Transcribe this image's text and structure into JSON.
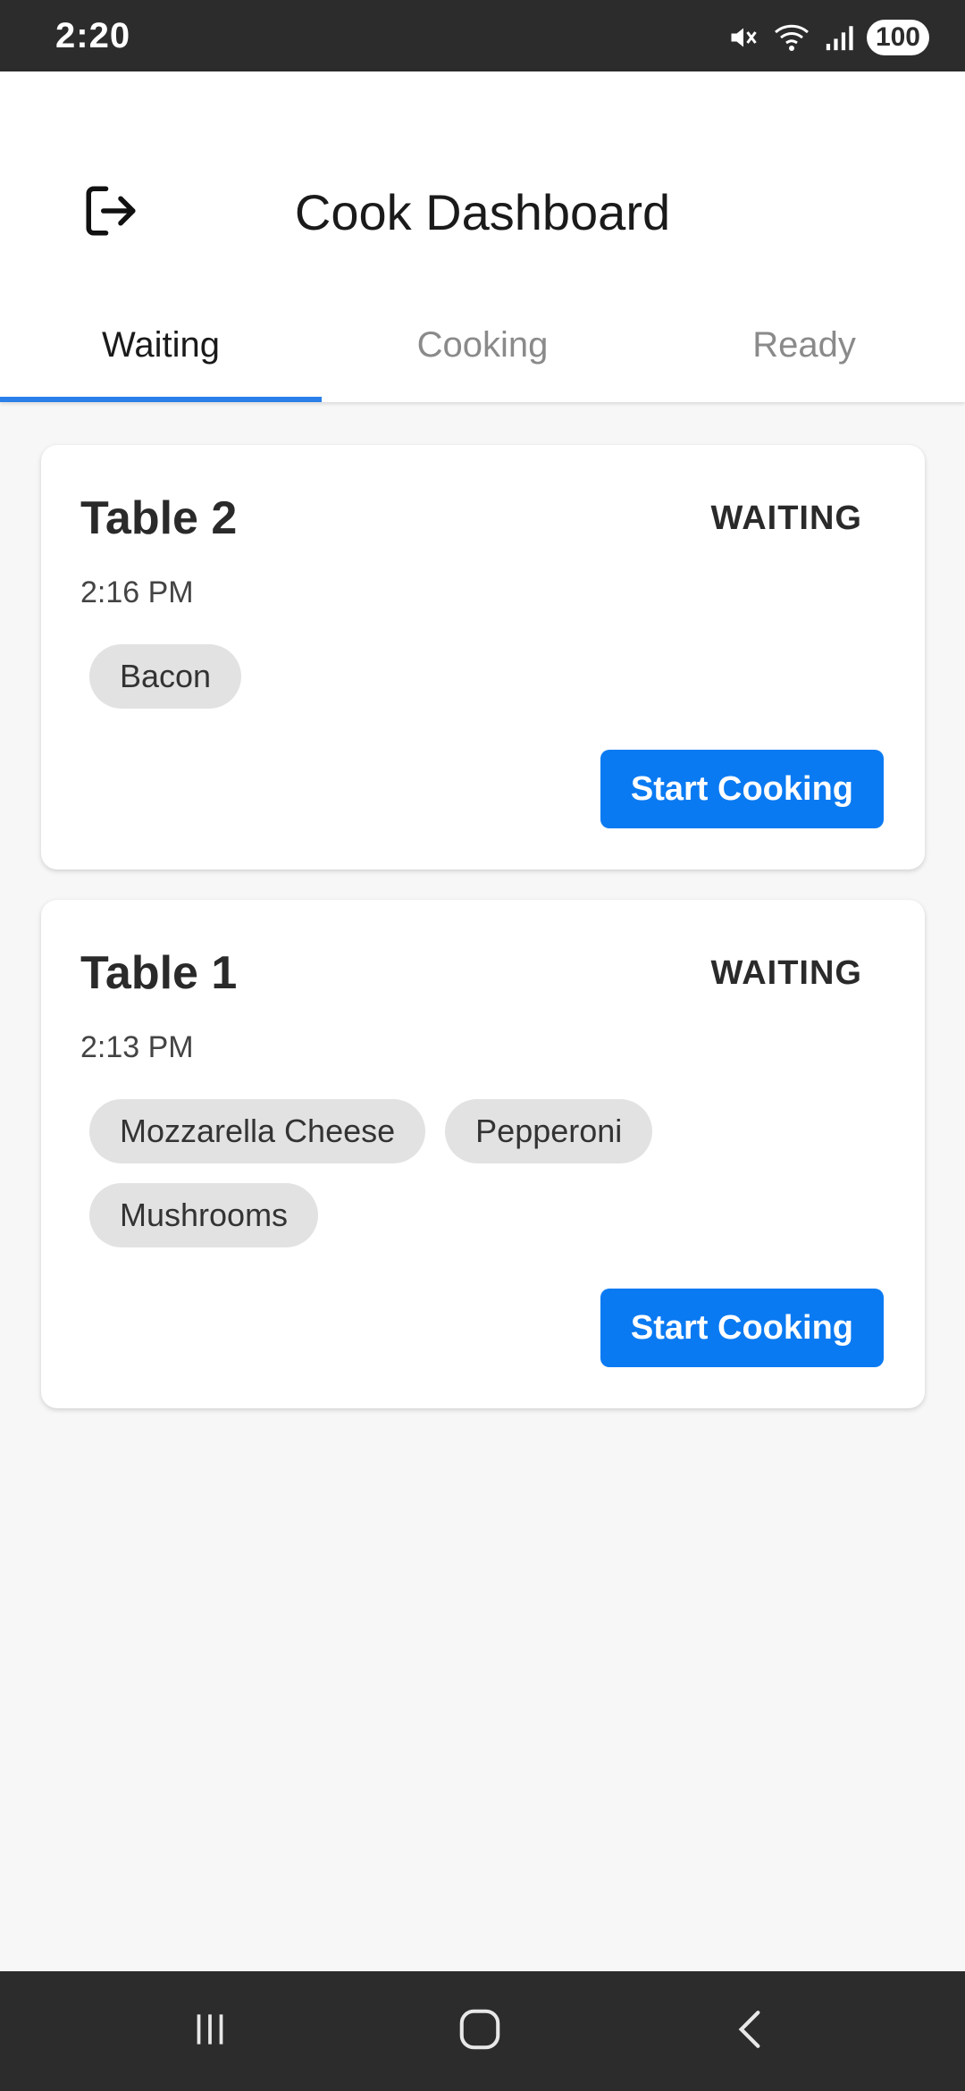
{
  "status_bar": {
    "time": "2:20",
    "battery": "100",
    "icons": [
      "mute-icon",
      "wifi-icon",
      "signal-icon"
    ]
  },
  "header": {
    "title": "Cook Dashboard",
    "logout_icon": "logout-icon"
  },
  "tabs": [
    {
      "label": "Waiting",
      "active": true
    },
    {
      "label": "Cooking",
      "active": false
    },
    {
      "label": "Ready",
      "active": false
    }
  ],
  "orders": [
    {
      "table": "Table 2",
      "status": "WAITING",
      "time": "2:16 PM",
      "items": [
        "Bacon"
      ],
      "action": "Start Cooking"
    },
    {
      "table": "Table 1",
      "status": "WAITING",
      "time": "2:13 PM",
      "items": [
        "Mozzarella Cheese",
        "Pepperoni",
        "Mushrooms"
      ],
      "action": "Start Cooking"
    }
  ],
  "colors": {
    "accent": "#0a7af2",
    "tab_indicator": "#2a7fe8",
    "chip_bg": "#e2e2e2",
    "page_bg": "#f7f7f7",
    "system_bar": "#2c2c2c"
  },
  "nav_bar": [
    "recent-apps-icon",
    "home-icon",
    "back-icon"
  ]
}
